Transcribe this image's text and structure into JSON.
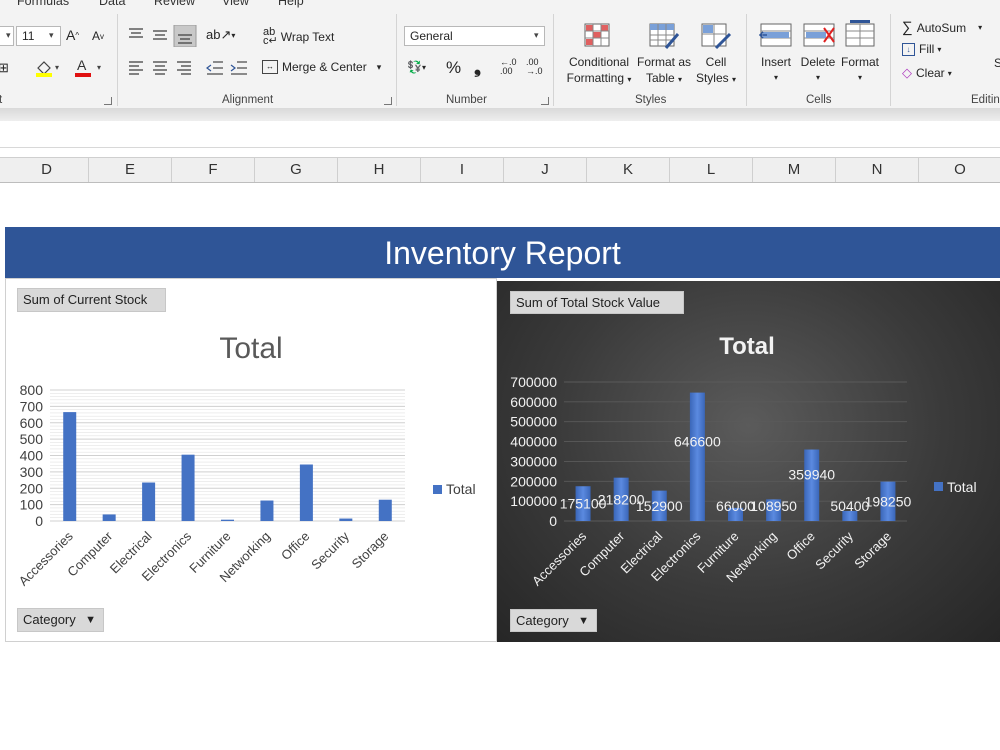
{
  "ribbon": {
    "menu_tabs": [
      "Formulas",
      "Data",
      "Review",
      "View",
      "Help"
    ],
    "font_size": "11",
    "number_format": "General",
    "buttons": {
      "wrap_text": "Wrap Text",
      "merge_center": "Merge & Center",
      "conditional_formatting_1": "Conditional",
      "conditional_formatting_2": "Formatting",
      "format_as_table_1": "Format as",
      "format_as_table_2": "Table",
      "cell_styles_1": "Cell",
      "cell_styles_2": "Styles",
      "insert": "Insert",
      "delete": "Delete",
      "format": "Format",
      "autosum": "AutoSum",
      "fill": "Fill",
      "clear": "Clear"
    },
    "group_labels": {
      "font_tail": "t",
      "alignment": "Alignment",
      "number": "Number",
      "styles": "Styles",
      "cells": "Cells",
      "editing": "Editin"
    }
  },
  "columns": [
    "D",
    "E",
    "F",
    "G",
    "H",
    "I",
    "J",
    "K",
    "L",
    "M",
    "N",
    "O"
  ],
  "report": {
    "title": "Inventory Report"
  },
  "colors": {
    "banner": "#2f5597",
    "bar": "#4472c4",
    "dark_bg": "#3a3a3a"
  },
  "chart_data": [
    {
      "type": "bar",
      "field_button": "Sum of Current Stock",
      "axis_button": "Category",
      "title": "Total",
      "categories": [
        "Accessories",
        "Computer",
        "Electrical",
        "Electronics",
        "Furniture",
        "Networking",
        "Office",
        "Security",
        "Storage"
      ],
      "series": [
        {
          "name": "Total",
          "values": [
            665,
            40,
            235,
            405,
            8,
            125,
            345,
            15,
            130
          ]
        }
      ],
      "ylim": [
        0,
        800
      ],
      "yticks": [
        "0",
        "100",
        "200",
        "300",
        "400",
        "500",
        "600",
        "700",
        "800"
      ],
      "legend": "right",
      "grid": true
    },
    {
      "type": "bar",
      "field_button": "Sum of Total Stock Value",
      "axis_button": "Category",
      "title": "Total",
      "categories": [
        "Accessories",
        "Computer",
        "Electrical",
        "Electronics",
        "Furniture",
        "Networking",
        "Office",
        "Security",
        "Storage"
      ],
      "series": [
        {
          "name": "Total",
          "values": [
            175100,
            218200,
            152900,
            646600,
            66000,
            108950,
            359940,
            50400,
            198250
          ]
        }
      ],
      "data_labels": [
        "175100",
        "218200",
        "152900",
        "646600",
        "66000",
        "108950",
        "359940",
        "50400",
        "198250"
      ],
      "ylim": [
        0,
        700000
      ],
      "yticks": [
        "0",
        "100000",
        "200000",
        "300000",
        "400000",
        "500000",
        "600000",
        "700000"
      ],
      "legend": "right",
      "grid": true
    }
  ]
}
